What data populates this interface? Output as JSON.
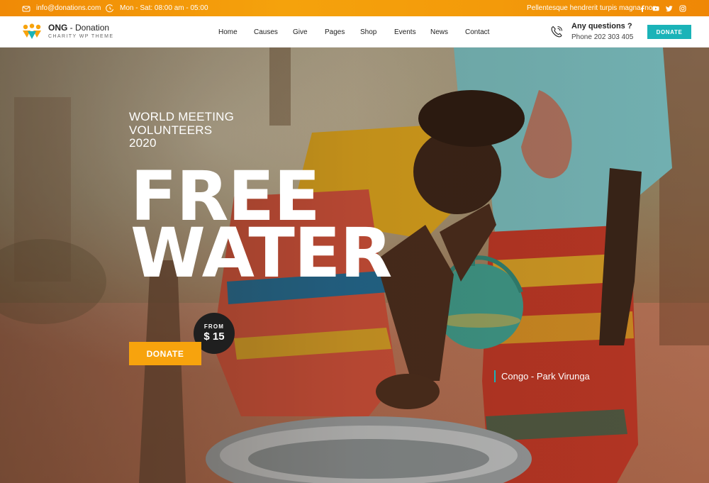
{
  "topbar": {
    "email": "info@donations.com",
    "hours": "Mon - Sat: 08:00 am - 05:00",
    "tagline": "Pellentesque hendrerit turpis magna, non",
    "socials": [
      "facebook-icon",
      "youtube-icon",
      "twitter-icon",
      "instagram-icon"
    ]
  },
  "header": {
    "brand_bold": "ONG",
    "brand_rest": " - Donation",
    "brand_sub": "CHARITY WP THEME",
    "nav": [
      "Home",
      "Causes",
      "Give",
      "Pages",
      "Shop",
      "Events",
      "News",
      "Contact"
    ],
    "contact_title": "Any questions ?",
    "contact_phone": "Phone 202 303 405",
    "donate_label": "DONATE"
  },
  "hero": {
    "tagline": [
      "WORLD MEETING",
      "VOLUNTEERS",
      "2020"
    ],
    "headline": [
      "FREE",
      "WATER"
    ],
    "price_from": "FROM",
    "price_value": "$ 15",
    "donate_label": "DONATE",
    "location": "Congo - Park Virunga"
  },
  "colors": {
    "topbar": "#f39a0a",
    "accent_teal": "#1ab3b8",
    "accent_orange": "#f7a30d",
    "badge_dark": "#1f1f1f"
  }
}
